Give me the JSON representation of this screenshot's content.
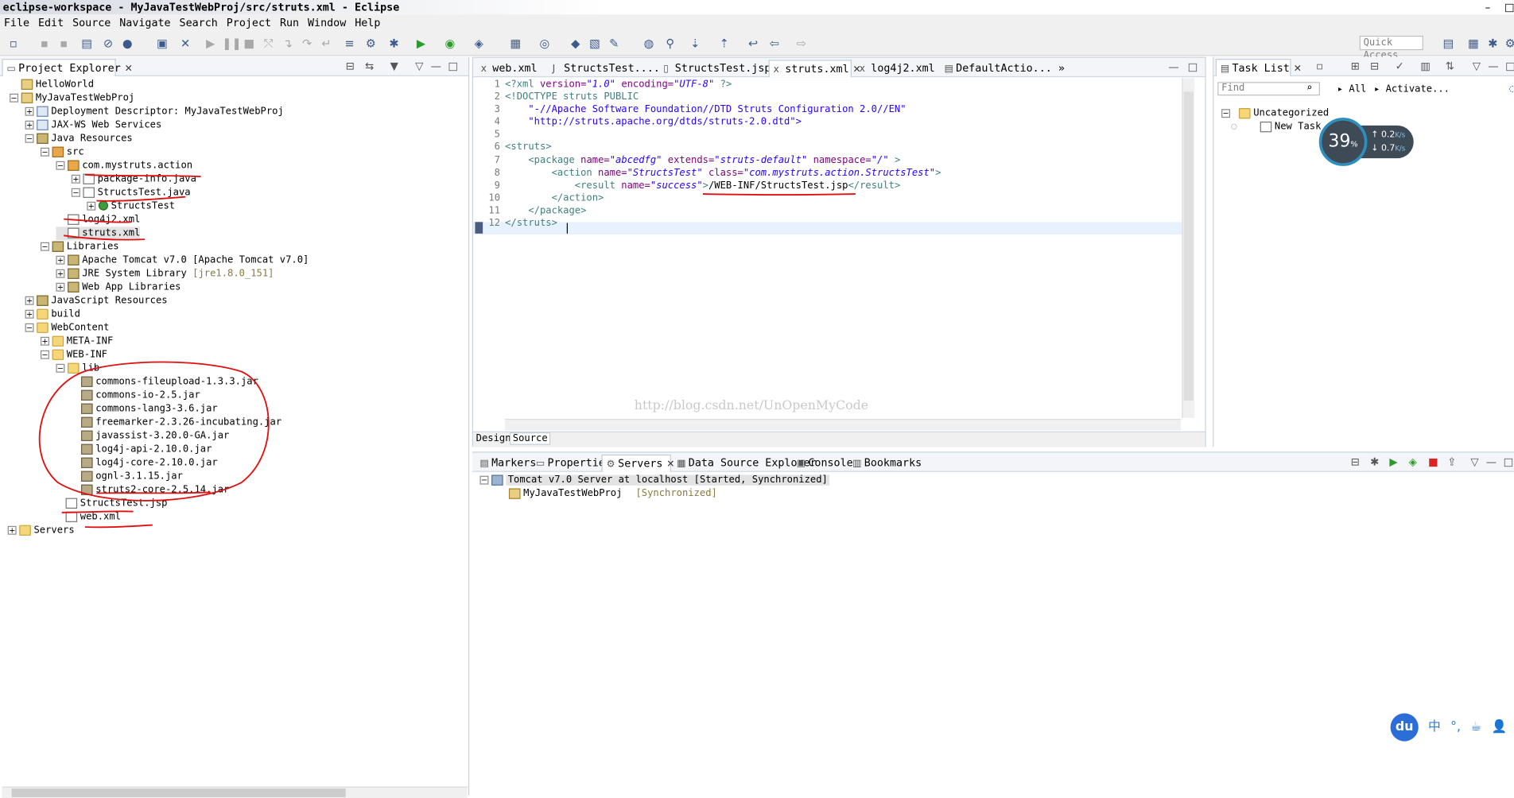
{
  "window": {
    "title": "eclipse-workspace - MyJavaTestWebProj/src/struts.xml - Eclipse",
    "controls": [
      "–",
      "□"
    ]
  },
  "menu": [
    "File",
    "Edit",
    "Source",
    "Navigate",
    "Search",
    "Project",
    "Run",
    "Window",
    "Help"
  ],
  "toolbar": {
    "quick_access_placeholder": "Quick Access"
  },
  "project_explorer": {
    "tab_label": "Project Explorer",
    "tree": [
      "HelloWorld",
      "MyJavaTestWebProj",
      "Deployment Descriptor: MyJavaTestWebProj",
      "JAX-WS Web Services",
      "Java Resources",
      "src",
      "com.mystruts.action",
      "package-info.java",
      "StructsTest.java",
      "StructsTest",
      "log4j2.xml",
      "struts.xml",
      "Libraries",
      "Apache Tomcat v7.0 [Apache Tomcat v7.0]",
      "JRE System Library",
      "[jre1.8.0_151]",
      "Web App Libraries",
      "JavaScript Resources",
      "build",
      "WebContent",
      "META-INF",
      "WEB-INF",
      "lib",
      "commons-fileupload-1.3.3.jar",
      "commons-io-2.5.jar",
      "commons-lang3-3.6.jar",
      "freemarker-2.3.26-incubating.jar",
      "javassist-3.20.0-GA.jar",
      "log4j-api-2.10.0.jar",
      "log4j-core-2.10.0.jar",
      "ognl-3.1.15.jar",
      "struts2-core-2.5.14.jar",
      "StructsTest.jsp",
      "web.xml",
      "Servers"
    ]
  },
  "editor": {
    "tabs": [
      "web.xml",
      "StructsTest....",
      "StructsTest.jsp",
      "struts.xml",
      "log4j2.xml",
      "DefaultActio...",
      "»"
    ],
    "active_tab": "struts.xml",
    "line_numbers": [
      "1",
      "2",
      "3",
      "4",
      "5",
      "6",
      "7",
      "8",
      "9",
      "10",
      "11",
      "12"
    ],
    "code": {
      "l1_a": "<?xml ",
      "l1_b": "version=",
      "l1_c": "\"1.0\"",
      "l1_d": " encoding=",
      "l1_e": "\"UTF-8\"",
      "l1_f": " ?>",
      "l2": "<!DOCTYPE struts PUBLIC",
      "l3": "    \"-//Apache Software Foundation//DTD Struts Configuration 2.0//EN\"",
      "l4": "    \"http://struts.apache.org/dtds/struts-2.0.dtd\">",
      "l6": "<struts>",
      "l7_a": "    <package ",
      "l7_b": "name=",
      "l7_c": "\"abcedfg\"",
      "l7_d": " extends=",
      "l7_e": "\"struts-default\"",
      "l7_f": " namespace=",
      "l7_g": "\"/\"",
      "l7_h": " >",
      "l8_a": "        <action ",
      "l8_b": "name=",
      "l8_c": "\"StructsTest\"",
      "l8_d": " class=",
      "l8_e": "\"com.mystruts.action.StructsTest\"",
      "l8_f": ">",
      "l9_a": "            <result ",
      "l9_b": "name=",
      "l9_c": "\"success\"",
      "l9_d": ">",
      "l9_e": "/WEB-INF/StructsTest.jsp",
      "l9_f": "</result>",
      "l10": "        </action>",
      "l11": "    </package>",
      "l12": "</struts>"
    },
    "bottom_tabs": [
      "Design",
      "Source"
    ],
    "watermark": "http://blog.csdn.net/UnOpenMyCode"
  },
  "task_list": {
    "tab_label": "Task List",
    "find_placeholder": "Find",
    "all_label": "All",
    "activate_label": "Activate...",
    "category": "Uncategorized",
    "task": "New Task"
  },
  "bottom_panel": {
    "tabs": [
      "Markers",
      "Properties",
      "Servers",
      "Data Source Explorer",
      "Console",
      "Bookmarks"
    ],
    "active_tab": "Servers",
    "server": "Tomcat v7.0 Server at localhost  [Started, Synchronized]",
    "module": "MyJavaTestWebProj",
    "module_state": "[Synchronized]"
  },
  "speed_widget": {
    "percent": "39",
    "percent_unit": "%",
    "up": "0.2",
    "down": "0.7",
    "unit": "K/s"
  },
  "ime": {
    "logo": "du",
    "lang": "中",
    "items": [
      "°,",
      "☕",
      "👤",
      "⚙"
    ]
  },
  "colors": {
    "tag": "#3f7f7f",
    "attr": "#7f007f",
    "value": "#2a00ff",
    "annotation": "#e01010"
  }
}
